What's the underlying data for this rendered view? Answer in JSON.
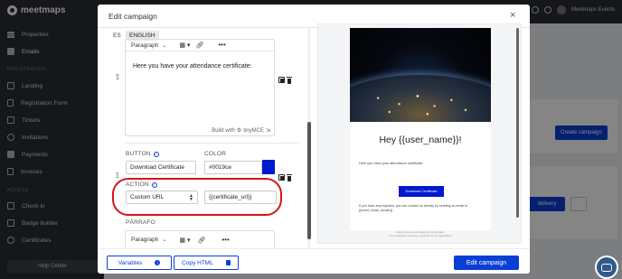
{
  "app": {
    "brand": "meetmaps",
    "user_name": "Meetmaps Events",
    "colors": {
      "primary": "#0a3fd6",
      "sidebar": "#2a2d34",
      "highlight_ring": "#d7141a"
    }
  },
  "sidebar": {
    "items_top": [
      {
        "label": "Properties",
        "icon": "sliders-icon"
      },
      {
        "label": "Emails",
        "icon": "envelope-icon"
      }
    ],
    "section_registration": "REGISTRATION",
    "items_registration": [
      {
        "label": "Landing",
        "icon": "page-icon"
      },
      {
        "label": "Registration Form",
        "icon": "form-icon"
      },
      {
        "label": "Tickets",
        "icon": "ticket-icon"
      },
      {
        "label": "Invitations",
        "icon": "invitation-icon"
      },
      {
        "label": "Payments",
        "icon": "payment-icon"
      },
      {
        "label": "Invoices",
        "icon": "invoice-icon"
      }
    ],
    "section_access": "ACCESS",
    "items_access": [
      {
        "label": "Check-in",
        "icon": "checkin-icon"
      },
      {
        "label": "Badge builder",
        "icon": "badge-icon"
      },
      {
        "label": "Certificates",
        "icon": "certificate-icon"
      }
    ],
    "help_label": "Help Center"
  },
  "background": {
    "create_campaign": "Create campaign",
    "delivery": "delivery"
  },
  "modal": {
    "title": "Edit campaign",
    "close": "×",
    "languages": [
      "ES",
      "ENGLISH"
    ],
    "toolbar": {
      "block_format": "Paragraph",
      "more": "•••"
    },
    "editor_text": "Here you have your attendance certificate:",
    "built_with": "Build with",
    "tinymce": "tinyMCE",
    "button_section": {
      "button_label": "BUTTON",
      "button_value": "Download Certificate",
      "color_label": "COLOR",
      "color_value": "#0019ce",
      "action_label": "ACTION",
      "action_value": "Custom URL",
      "url_value": "{{certificate_url}}"
    },
    "paragraph_label": "PÁRRAFO",
    "toolbar2": {
      "block_format": "Paragraph",
      "more": "•••"
    },
    "preview": {
      "heading": "Hey {{user_name}}!",
      "body": "Here you have your attendance certificate:",
      "button": "Download Certificate",
      "footer": "If you have any inquiries, you can contact us directly by sending an email to {{event_email_sender}}",
      "legal_1": "Este correo fue enviado por Meetmaps",
      "legal_2": "Para cualquier consulta, contacta con el organizador"
    },
    "footer": {
      "variables": "Variables",
      "copy_html": "Copy HTML",
      "edit_campaign": "Edit campaign"
    }
  }
}
